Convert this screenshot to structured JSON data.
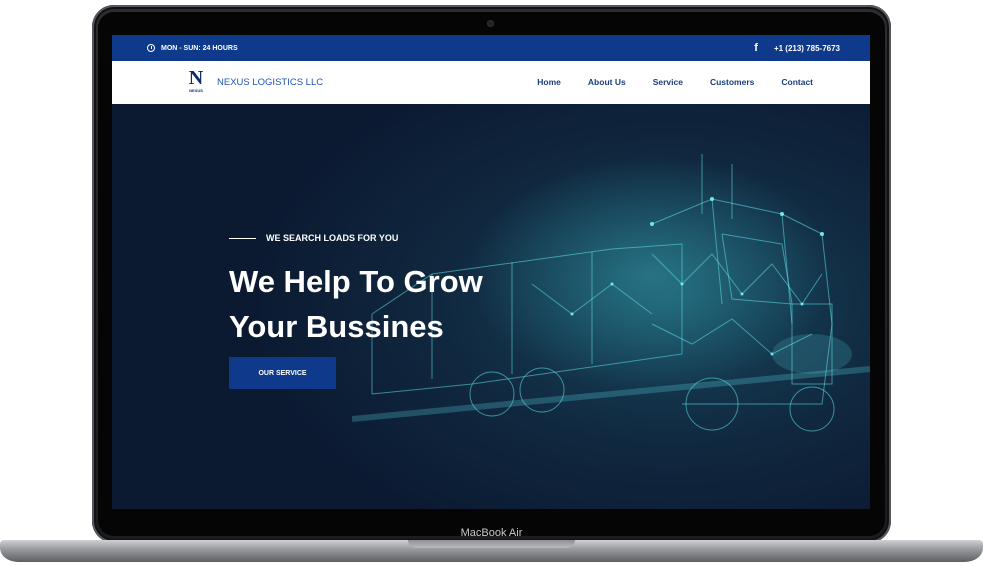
{
  "topbar": {
    "hours": "MON - SUN: 24 HOURS",
    "facebook_icon": "facebook-icon",
    "phone": "+1 (213) 785-7673"
  },
  "navbar": {
    "logo_letter": "N",
    "logo_text": "NEXUS",
    "brand_name": "NEXUS LOGISTICS LLC",
    "menu": [
      "Home",
      "About Us",
      "Service",
      "Customers",
      "Contact"
    ]
  },
  "hero": {
    "eyebrow": "WE SEARCH LOADS FOR YOU",
    "headline_line1": "We Help To Grow",
    "headline_line2": "Your Bussines",
    "cta_label": "OUR SERVICE"
  },
  "device": {
    "label": "MacBook Air"
  },
  "colors": {
    "primary_blue": "#0f3a8c",
    "hero_dark": "#0b1a31",
    "accent_cyan": "#46d2dc"
  }
}
